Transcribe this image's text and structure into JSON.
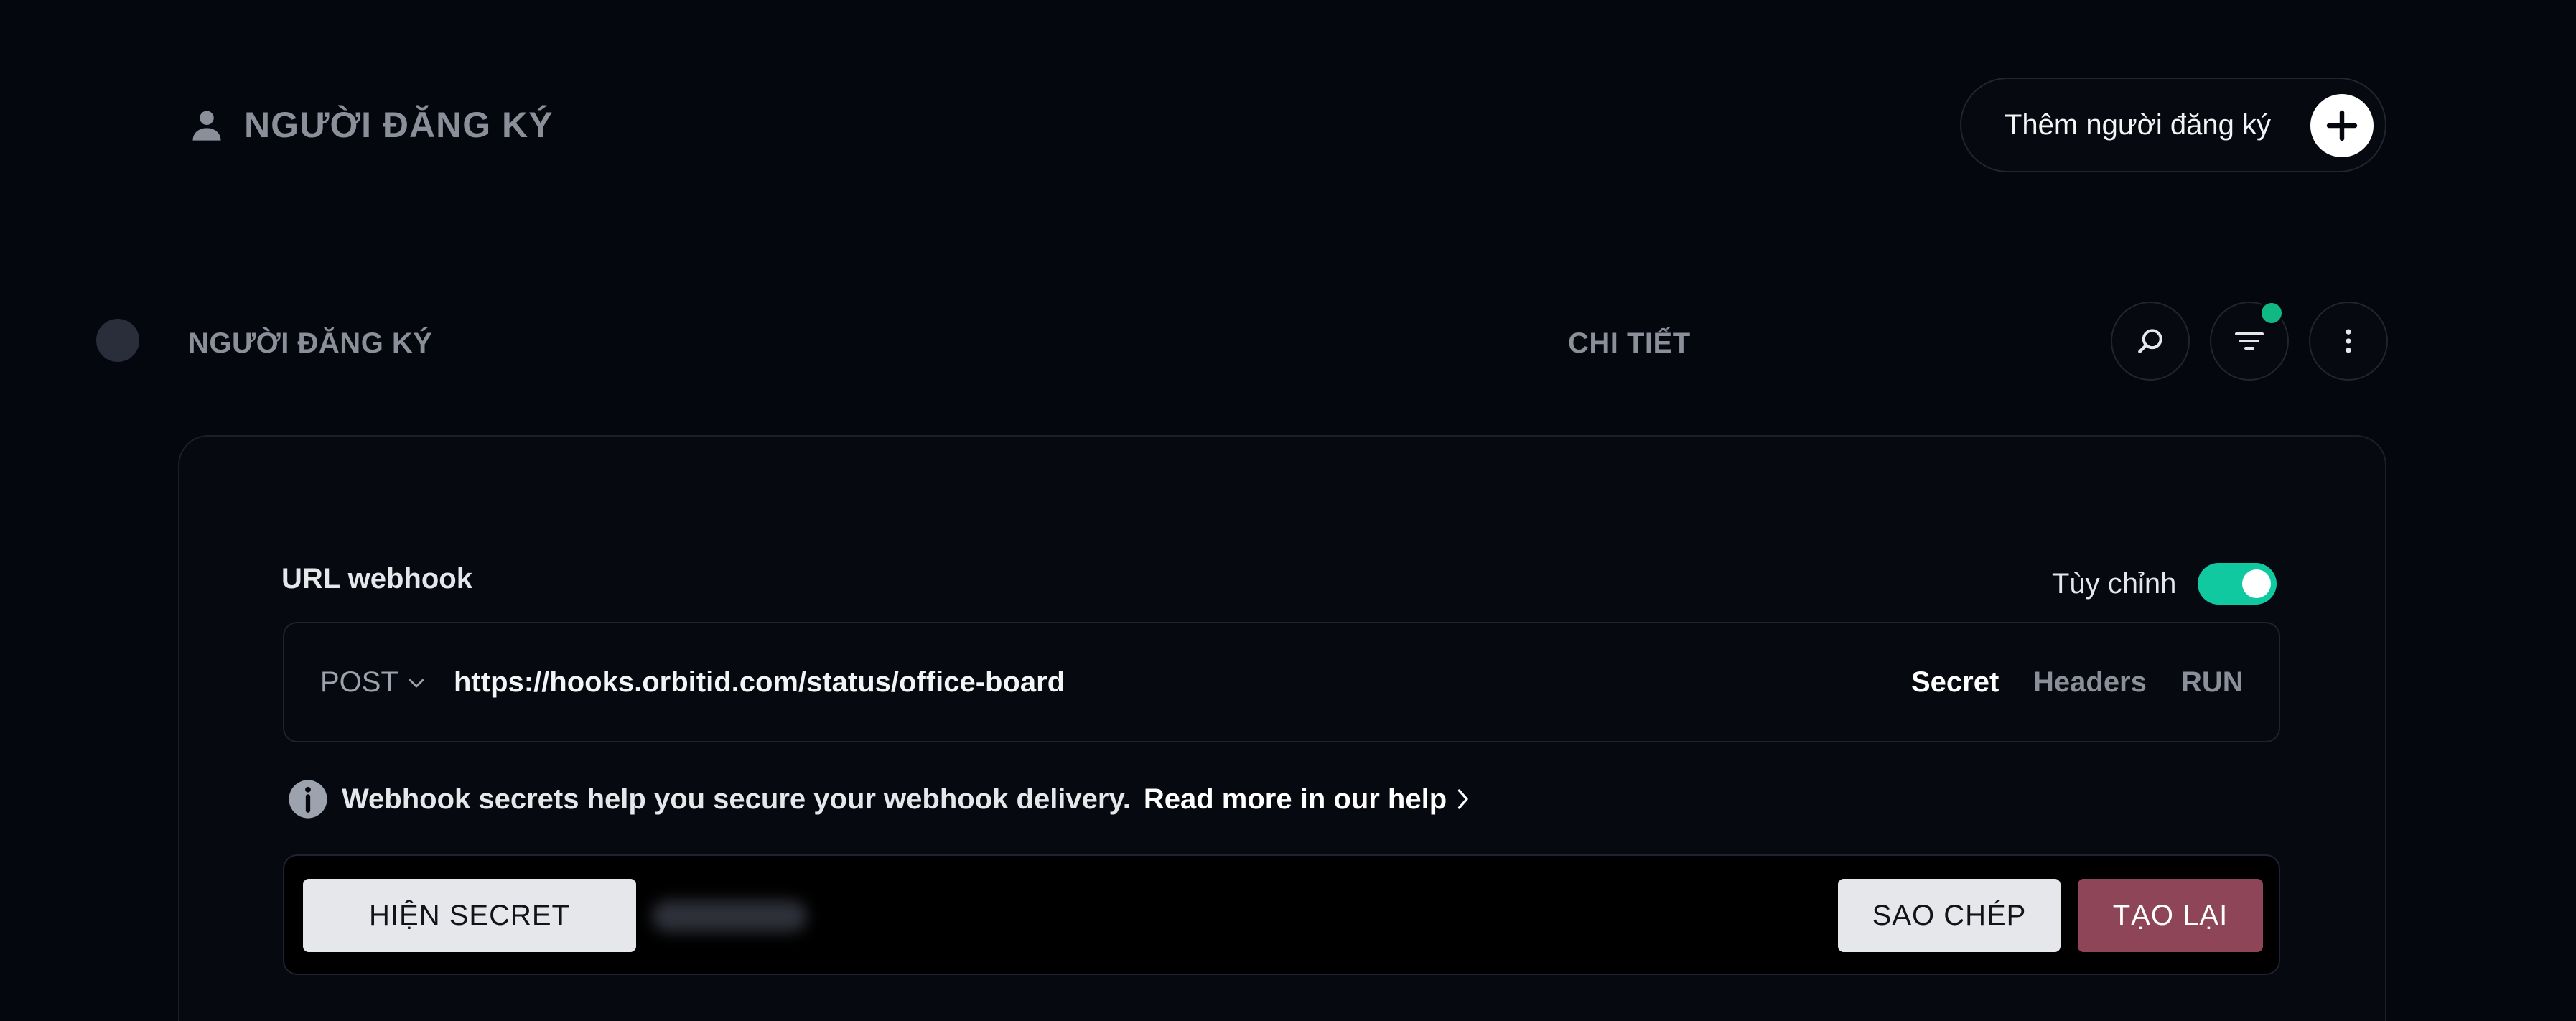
{
  "header": {
    "title": "NGƯỜI ĐĂNG KÝ",
    "add_button_label": "Thêm người đăng ký",
    "title_icon": "person-icon",
    "add_icon": "plus-icon"
  },
  "list_header": {
    "subscriber_column": "NGƯỜI ĐĂNG KÝ",
    "details_column": "CHI TIẾT",
    "actions": {
      "search_icon": "search-icon",
      "filter_icon": "filter-icon",
      "more_icon": "more-vertical-icon"
    },
    "filter_badge_color": "#10b981"
  },
  "webhook": {
    "label": "URL webhook",
    "custom_label": "Tùy chỉnh",
    "custom_enabled": true,
    "method": "POST",
    "url": "https://hooks.orbitid.com/status/office-board",
    "tabs": [
      "Secret",
      "Headers",
      "RUN"
    ],
    "active_tab": "Secret",
    "info_text": "Webhook secrets help you secure your webhook delivery.",
    "help_link": "Read more in our help",
    "show_secret_label": "HIỆN SECRET",
    "copy_label": "SAO CHÉP",
    "regenerate_label": "TẠO LẠI"
  },
  "colors": {
    "background": "#05070f",
    "accent": "#10c9a0",
    "danger": "#8e4558"
  }
}
